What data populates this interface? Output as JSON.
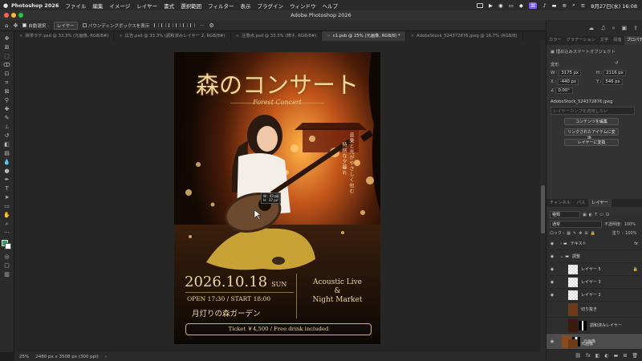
{
  "menubar": {
    "app_name": "Photoshop 2026",
    "items": [
      "ファイル",
      "編集",
      "イメージ",
      "レイヤー",
      "書式",
      "選択範囲",
      "フィルター",
      "表示",
      "プラグイン",
      "ウィンドウ",
      "ヘルプ"
    ],
    "clock": "8月27日(水) 16:08"
  },
  "window": {
    "title": "Adobe Photoshop 2026"
  },
  "options": {
    "auto_select_label": "自動選択 :",
    "auto_select_target": "レイヤー",
    "bounding_box_label": "バウンディングボックスを表示",
    "more": "···"
  },
  "tabs": [
    {
      "label": "抹茶ラテ.psd @ 33.3% (元画像, RGB/8#)",
      "active": false
    },
    {
      "label": "広告.psd @ 33.3% (調和済みレイヤー 2, RGB/8#)",
      "active": false
    },
    {
      "label": "注意点.psd @ 33.3% (椅子, RGB/8#)",
      "active": false
    },
    {
      "label": "c1.psb @ 25% (元画像, RGB/8) *",
      "active": true
    },
    {
      "label": "AdobeStock_524372876.jpeg @ 16.7% (RGB/8)",
      "active": false
    }
  ],
  "poster": {
    "title": "森のコンサート",
    "subtitle": "Forest Concert",
    "vertical_text_1": "音楽と光がやさしく包む",
    "vertical_text_2": "特別な夕暮れ",
    "date": "2026.10.18",
    "day": "SUN",
    "time": "OPEN 17:30 / START 18:00",
    "venue": "月灯りの森ガーデン",
    "event_line1": "Acoustic Live",
    "event_line2": "&",
    "event_line3": "Night Market",
    "ticket": "Ticket ￥4,500 / Free drink included",
    "tooltip_w": "W : 43 px",
    "tooltip_h": "H : 37 px"
  },
  "status": {
    "zoom": "25%",
    "doc_info": "2480 px x 3508 px (300 ppi)"
  },
  "panel_tabs": [
    "カラー",
    "グラデーション",
    "文字",
    "段落",
    "プロパティ"
  ],
  "properties": {
    "header": "埋め込みスマートオブジェクト",
    "section": "変形",
    "w_label": "W :",
    "w_value": "3175 px",
    "h_label": "H :",
    "h_value": "2116 px",
    "x_label": "X :",
    "x_value": "-440 px",
    "y_label": "Y :",
    "y_value": "546 px",
    "angle_value": "0.00°",
    "file_name": "AdobeStock_524372876.jpeg",
    "comp_placeholder": "レイヤーカンプを適用しない",
    "btn_edit": "コンテンツを編集",
    "btn_update": "リンクされたアイテムに変換...",
    "btn_convert": "レイヤーに変換"
  },
  "layer_tabs": [
    "チャンネル",
    "パス",
    "レイヤー"
  ],
  "layers_panel": {
    "filter_kind": "種類",
    "blend_mode": "通常",
    "opacity_label": "不透明度:",
    "opacity_value": "100%",
    "lock_label": "ロック :",
    "fill_label": "塗り :",
    "fill_value": "100%"
  },
  "layers": [
    {
      "name": "テキスト",
      "kind": "group"
    },
    {
      "name": "調整",
      "kind": "group"
    },
    {
      "name": "レイヤー 5",
      "kind": "layer"
    },
    {
      "name": "レイヤー 3",
      "kind": "layer"
    },
    {
      "name": "レイヤー 2",
      "kind": "layer"
    },
    {
      "name": "切り抜き",
      "kind": "layer"
    },
    {
      "name": "調和済みレイヤー",
      "kind": "layer"
    },
    {
      "name": "元画像",
      "kind": "layer"
    },
    {
      "name": "元画像",
      "kind": "layer"
    }
  ]
}
